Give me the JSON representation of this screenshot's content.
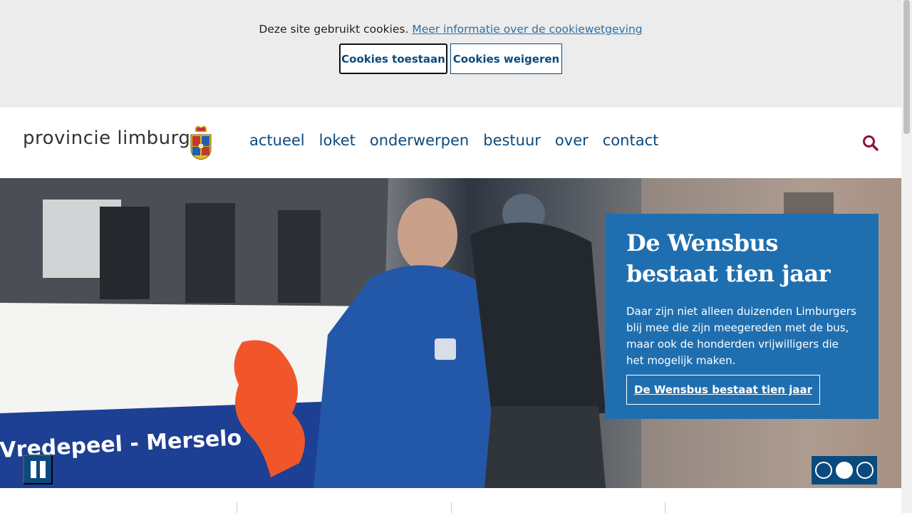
{
  "cookie": {
    "message": "Deze site gebruikt cookies.",
    "link": "Meer informatie over de cookiewetgeving",
    "accept": "Cookies toestaan",
    "refuse": "Cookies weigeren"
  },
  "header": {
    "logo_text": "provincie limburg",
    "nav": [
      "actueel",
      "loket",
      "onderwerpen",
      "bestuur",
      "over",
      "contact"
    ],
    "search_icon": "search-icon"
  },
  "hero": {
    "title": "De Wensbus bestaat tien jaar",
    "description": "Daar zijn niet alleen duizenden Limburgers blij mee die zijn meegereden met de bus, maar ook de honderden vrijwilligers die het mogelijk maken.",
    "cta": "De Wensbus bestaat tien jaar",
    "bus_text": "Vredepeel - Merselo",
    "slides": 3,
    "active_slide": 2
  },
  "colors": {
    "brand_blue": "#0b4a7e",
    "card_blue": "#1f6fb0",
    "accent_maroon": "#8a1538"
  }
}
